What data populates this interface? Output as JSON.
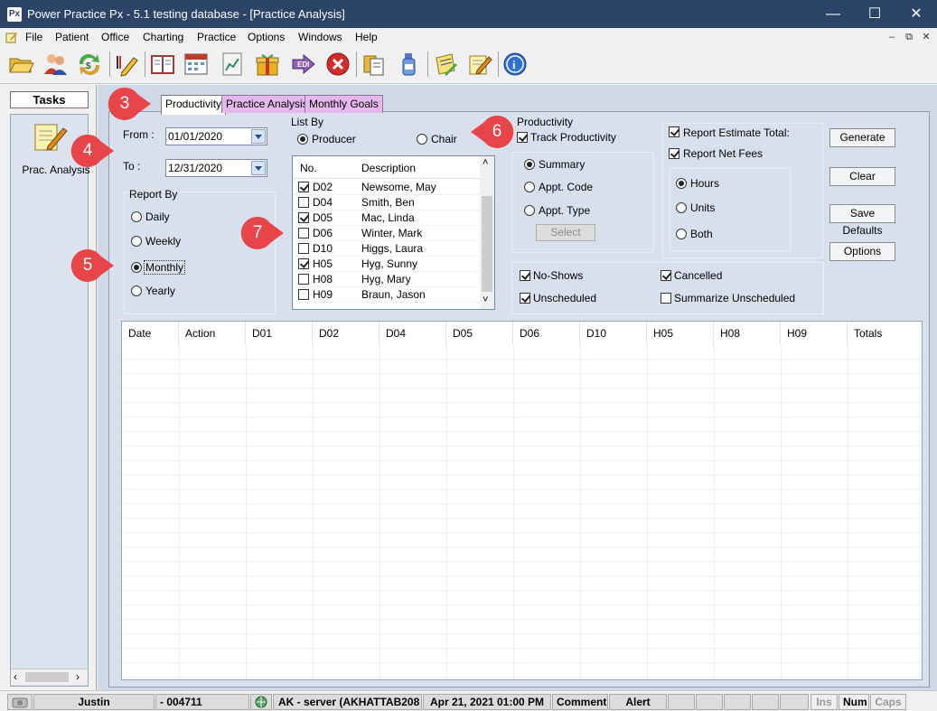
{
  "window": {
    "app_icon": "Px",
    "title": "Power Practice Px - 5.1 testing database - [Practice Analysis]",
    "minimize": "—",
    "maximize": "☐",
    "close": "✕"
  },
  "menu": {
    "items": [
      "File",
      "Patient",
      "Office",
      "Charting",
      "Practice",
      "Options",
      "Windows",
      "Help"
    ],
    "mdi_minimize": "–",
    "mdi_restore": "⧉",
    "mdi_close": "✕"
  },
  "toolbar": {
    "icons": [
      "open-folder-icon",
      "patients-icon",
      "money-transfer-icon",
      "edit-pencil-icon",
      "book-icon",
      "calendar-icon",
      "chart-icon",
      "gift-box-icon",
      "edi-icon",
      "stop-icon",
      "document-icon",
      "spray-bottle-icon",
      "notes-icon",
      "notepad-icon",
      "info-icon"
    ]
  },
  "tasks": {
    "title": "Tasks",
    "item_label": "Prac. Analysis"
  },
  "tabs": [
    "Productivity",
    "Practice Analysis",
    "Monthly Goals"
  ],
  "form": {
    "from_label": "From :",
    "from_value": "01/01/2020",
    "to_label": "To :",
    "to_value": "12/31/2020",
    "report_by": {
      "label": "Report By",
      "options": [
        "Daily",
        "Weekly",
        "Monthly",
        "Yearly"
      ],
      "selected": "Monthly"
    },
    "list_by": {
      "label": "List By",
      "producer": "Producer",
      "chair": "Chair",
      "selected": "Producer"
    },
    "producers": {
      "col_no": "No.",
      "col_desc": "Description",
      "rows": [
        {
          "no": "D02",
          "desc": "Newsome, May",
          "checked": true
        },
        {
          "no": "D04",
          "desc": "Smith, Ben",
          "checked": false
        },
        {
          "no": "D05",
          "desc": "Mac, Linda",
          "checked": true
        },
        {
          "no": "D06",
          "desc": "Winter, Mark",
          "checked": false
        },
        {
          "no": "D10",
          "desc": "Higgs, Laura",
          "checked": false
        },
        {
          "no": "H05",
          "desc": "Hyg, Sunny",
          "checked": true
        },
        {
          "no": "H08",
          "desc": "Hyg, Mary",
          "checked": false
        },
        {
          "no": "H09",
          "desc": "Braun, Jason",
          "checked": false
        }
      ]
    },
    "productivity": {
      "label": "Productivity",
      "track": "Track Productivity",
      "track_checked": true,
      "summary": "Summary",
      "appt_code": "Appt. Code",
      "appt_type": "Appt. Type",
      "selected": "Summary",
      "select_button": "Select"
    },
    "report_estimate_total": "Report Estimate Total:",
    "report_net_fees": "Report Net Fees",
    "units": {
      "hours": "Hours",
      "units": "Units",
      "both": "Both",
      "selected": "Hours"
    },
    "no_shows": "No-Shows",
    "cancelled": "Cancelled",
    "unscheduled": "Unscheduled",
    "summarize_unscheduled": "Summarize Unscheduled"
  },
  "buttons": {
    "generate": "Generate",
    "clear": "Clear",
    "save_defaults": "Save Defaults",
    "options": "Options"
  },
  "grid": {
    "columns": [
      "Date",
      "Action",
      "D01",
      "D02",
      "D04",
      "D05",
      "D06",
      "D10",
      "H05",
      "H08",
      "H09",
      "Totals"
    ]
  },
  "callouts": [
    "3",
    "4",
    "5",
    "6",
    "7"
  ],
  "status": {
    "user": "Justin",
    "id": "- 004711",
    "server": "AK - server (AKHATTAB208",
    "datetime": "Apr 21, 2021 01:00 PM",
    "comment": "Comment",
    "alert": "Alert",
    "ins": "Ins",
    "num": "Num",
    "caps": "Caps"
  },
  "colors": {
    "titlebar": "#2b4467",
    "tab_inactive": "#e6b7ec",
    "callout": "#e8454a",
    "panel": "#d8e0ed"
  }
}
